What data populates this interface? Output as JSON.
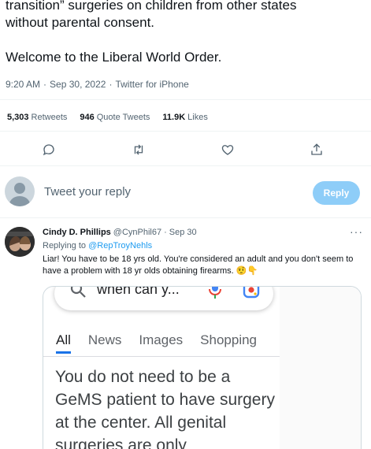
{
  "tweet": {
    "text_line1": "transition” surgeries on children from other states",
    "text_line2": "without parental consent.",
    "text_line3": "Welcome to the Liberal World Order.",
    "time": "9:20 AM",
    "sep1": "·",
    "date": "Sep 30, 2022",
    "sep2": "·",
    "source": "Twitter for iPhone"
  },
  "stats": {
    "retweets_count": "5,303",
    "retweets_label": "Retweets",
    "quotes_count": "946",
    "quotes_label": "Quote Tweets",
    "likes_count": "11.9K",
    "likes_label": "Likes"
  },
  "actions": [
    "reply-icon",
    "retweet-icon",
    "like-icon",
    "share-icon"
  ],
  "compose": {
    "placeholder": "Tweet your reply",
    "button": "Reply",
    "button_color": "#8ecdf8"
  },
  "reply": {
    "name": "Cindy D. Phillips",
    "handle": "@CynPhil67",
    "sep": "·",
    "date": "Sep 30",
    "more": "···",
    "replying_prefix": "Replying to",
    "replying_handle": "@RepTroyNehls",
    "body": "Liar! You have to be 18 yrs old. You're considered an adult and you don't seem to have a problem with 18 yr olds obtaining firearms. 🤨👇"
  },
  "media": {
    "search_query": "when can y...",
    "tabs": [
      "All",
      "News",
      "Images",
      "Shopping"
    ],
    "answer": "You do not need to be a GeMS patient to have surgery at the center. All genital surgeries are only"
  },
  "colors": {
    "link": "#1d9bf0",
    "muted": "#536471",
    "google_blue": "#1a73e8"
  }
}
